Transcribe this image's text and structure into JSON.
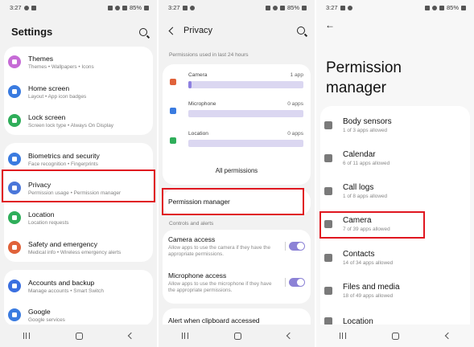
{
  "status_bar": {
    "time": "3:27",
    "battery": "85%"
  },
  "settings": {
    "title": "Settings",
    "groups": [
      [
        {
          "label": "Themes",
          "sub": "Themes • Wallpapers • Icons",
          "color": "#c66bd6",
          "icon": "themes-icon"
        },
        {
          "label": "Home screen",
          "sub": "Layout • App icon badges",
          "color": "#3a7be0",
          "icon": "home-screen-icon"
        },
        {
          "label": "Lock screen",
          "sub": "Screen lock type • Always On Display",
          "color": "#2fae5a",
          "icon": "lock-icon"
        }
      ],
      [
        {
          "label": "Biometrics and security",
          "sub": "Face recognition • Fingerprints",
          "color": "#3a7be0",
          "icon": "shield-icon"
        },
        {
          "label": "Privacy",
          "sub": "Permission usage • Permission manager",
          "color": "#4a76d9",
          "icon": "privacy-icon"
        },
        {
          "label": "Location",
          "sub": "Location requests",
          "color": "#2fae5a",
          "icon": "location-icon"
        },
        {
          "label": "Safety and emergency",
          "sub": "Medical info • Wireless emergency alerts",
          "color": "#e0623a",
          "icon": "emergency-icon"
        }
      ],
      [
        {
          "label": "Accounts and backup",
          "sub": "Manage accounts • Smart Switch",
          "color": "#3a6fe0",
          "icon": "accounts-icon"
        },
        {
          "label": "Google",
          "sub": "Google services",
          "color": "#3a7be0",
          "icon": "google-icon"
        }
      ]
    ]
  },
  "privacy": {
    "title": "Privacy",
    "used_label": "Permissions used in last 24 hours",
    "permissions": [
      {
        "name": "Camera",
        "count": "1 app",
        "fill_fraction": 0.03,
        "color": "#e0623a",
        "icon": "camera-icon"
      },
      {
        "name": "Microphone",
        "count": "0 apps",
        "fill_fraction": 0,
        "color": "#3a7be0",
        "icon": "microphone-icon"
      },
      {
        "name": "Location",
        "count": "0 apps",
        "fill_fraction": 0,
        "color": "#2fae5a",
        "icon": "location-icon"
      }
    ],
    "all_permissions": "All permissions",
    "permission_manager": "Permission manager",
    "controls_label": "Controls and alerts",
    "controls": [
      {
        "label": "Camera access",
        "sub": "Allow apps to use the camera if they have the appropriate permissions.",
        "on": true
      },
      {
        "label": "Microphone access",
        "sub": "Allow apps to use the microphone if they have the appropriate permissions.",
        "on": true
      },
      {
        "label": "Alert when clipboard accessed",
        "sub": ""
      }
    ]
  },
  "permission_manager": {
    "title_line1": "Permission",
    "title_line2": "manager",
    "items": [
      {
        "label": "Body sensors",
        "sub": "1 of 3 apps allowed",
        "icon": "heart-monitor-icon"
      },
      {
        "label": "Calendar",
        "sub": "6 of 11 apps allowed",
        "icon": "calendar-icon"
      },
      {
        "label": "Call logs",
        "sub": "1 of 8 apps allowed",
        "icon": "call-log-icon"
      },
      {
        "label": "Camera",
        "sub": "7 of 39 apps allowed",
        "icon": "camera-icon"
      },
      {
        "label": "Contacts",
        "sub": "14 of 34 apps allowed",
        "icon": "contacts-icon"
      },
      {
        "label": "Files and media",
        "sub": "18 of 49 apps allowed",
        "icon": "folder-icon"
      },
      {
        "label": "Location",
        "sub": "",
        "icon": "location-icon"
      }
    ]
  },
  "highlight_color": "#e0161f"
}
